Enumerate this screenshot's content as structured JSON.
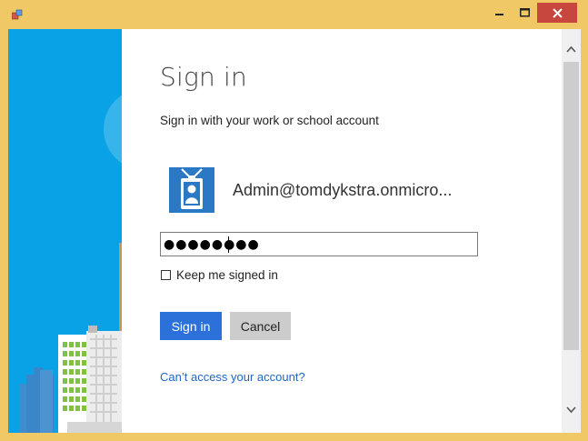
{
  "window": {
    "title": "",
    "frame_color": "#f0c866",
    "close_color": "#c7463d",
    "controls": [
      "minimize-icon",
      "maximize-icon",
      "close-icon"
    ]
  },
  "signin": {
    "heading": "Sign in",
    "subtitle": "Sign in with your work or school account",
    "account": "Admin@tomdykstra.onmicro...",
    "password_mask": "●●●●●●●●",
    "keep_signed_in_label": "Keep me signed in",
    "keep_signed_in_checked": false,
    "signin_button": "Sign in",
    "cancel_button": "Cancel",
    "help_link": "Can’t access your account?"
  },
  "colors": {
    "accent_blue": "#2b71d9",
    "illustration_blue": "#0aa2e6",
    "tile_blue": "#2b79c5",
    "link_blue": "#1f66c4"
  },
  "icons": {
    "tile": "id-badge-icon",
    "scroll_up": "chevron-up-icon",
    "scroll_down": "chevron-down-icon"
  }
}
